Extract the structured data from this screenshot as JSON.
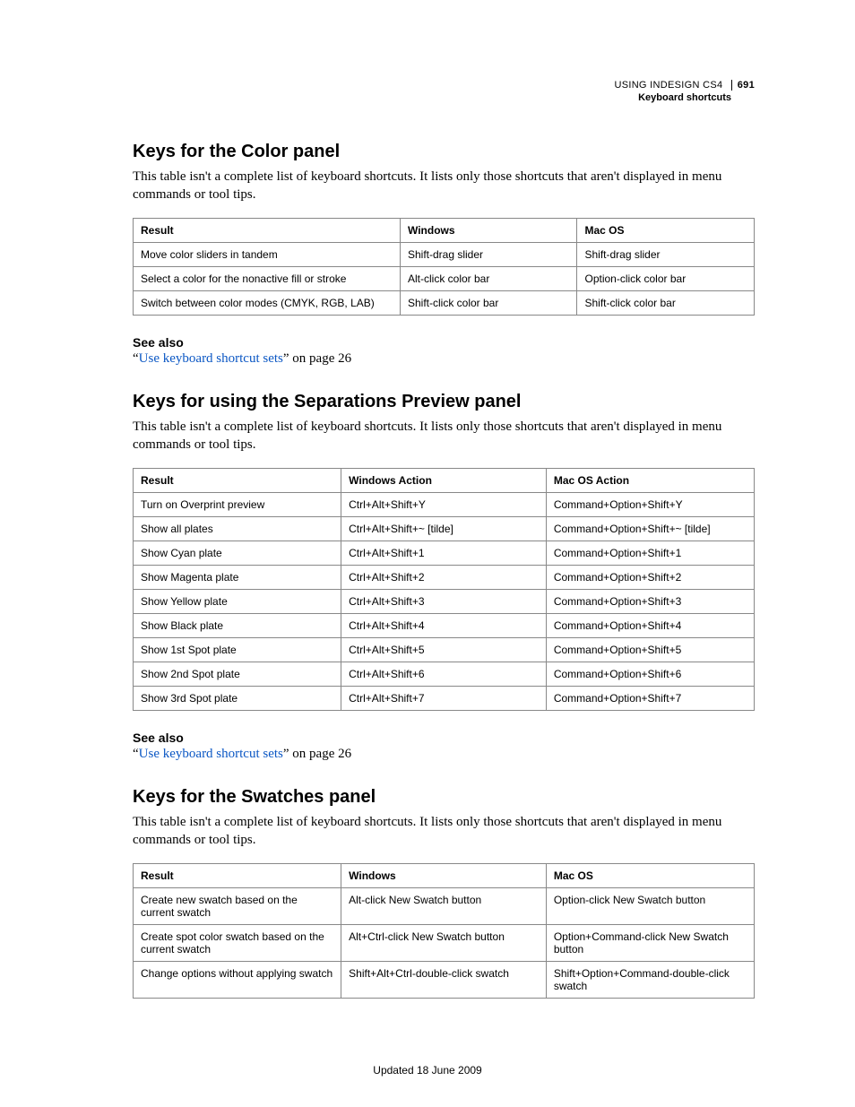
{
  "header": {
    "doc_title": "USING INDESIGN CS4",
    "page_number": "691",
    "section": "Keyboard shortcuts"
  },
  "intro_text": "This table isn't a complete list of keyboard shortcuts. It lists only those shortcuts that aren't displayed in menu commands or tool tips.",
  "see_also": {
    "heading": "See also",
    "quote_open": "“",
    "link_text": "Use keyboard shortcut sets",
    "suffix": "” on page 26"
  },
  "sections": [
    {
      "title": "Keys for the Color panel",
      "headers": [
        "Result",
        "Windows",
        "Mac OS"
      ],
      "col_widths": [
        "43%",
        "28.5%",
        "28.5%"
      ],
      "rows": [
        [
          "Move color sliders in tandem",
          "Shift-drag slider",
          "Shift-drag slider"
        ],
        [
          "Select a color for the nonactive fill or stroke",
          "Alt-click color bar",
          "Option-click color bar"
        ],
        [
          "Switch between color modes (CMYK, RGB, LAB)",
          "Shift-click color bar",
          "Shift-click color bar"
        ]
      ]
    },
    {
      "title": "Keys for using the Separations Preview panel",
      "headers": [
        "Result",
        "Windows Action",
        "Mac OS Action"
      ],
      "col_widths": [
        "33.5%",
        "33%",
        "33.5%"
      ],
      "rows": [
        [
          "Turn on Overprint preview",
          "Ctrl+Alt+Shift+Y",
          "Command+Option+Shift+Y"
        ],
        [
          "Show all plates",
          "Ctrl+Alt+Shift+~ [tilde]",
          "Command+Option+Shift+~ [tilde]"
        ],
        [
          "Show Cyan plate",
          "Ctrl+Alt+Shift+1",
          "Command+Option+Shift+1"
        ],
        [
          "Show Magenta plate",
          "Ctrl+Alt+Shift+2",
          "Command+Option+Shift+2"
        ],
        [
          "Show Yellow plate",
          "Ctrl+Alt+Shift+3",
          "Command+Option+Shift+3"
        ],
        [
          "Show Black plate",
          "Ctrl+Alt+Shift+4",
          "Command+Option+Shift+4"
        ],
        [
          "Show 1st Spot plate",
          "Ctrl+Alt+Shift+5",
          "Command+Option+Shift+5"
        ],
        [
          "Show 2nd Spot plate",
          "Ctrl+Alt+Shift+6",
          "Command+Option+Shift+6"
        ],
        [
          "Show 3rd Spot plate",
          "Ctrl+Alt+Shift+7",
          "Command+Option+Shift+7"
        ]
      ]
    },
    {
      "title": "Keys for the Swatches panel",
      "headers": [
        "Result",
        "Windows",
        "Mac OS"
      ],
      "col_widths": [
        "33.5%",
        "33%",
        "33.5%"
      ],
      "rows": [
        [
          "Create new swatch based on the current swatch",
          "Alt-click New Swatch button",
          "Option-click New Swatch button"
        ],
        [
          "Create spot color swatch based on the current swatch",
          "Alt+Ctrl-click New Swatch button",
          "Option+Command-click New Swatch button"
        ],
        [
          "Change options without applying swatch",
          "Shift+Alt+Ctrl-double-click swatch",
          "Shift+Option+Command-double-click swatch"
        ]
      ]
    }
  ],
  "footer": "Updated 18 June 2009"
}
